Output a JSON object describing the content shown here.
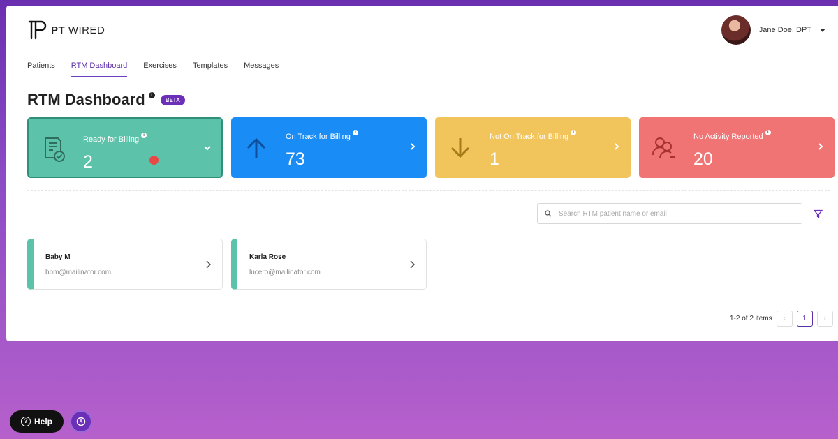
{
  "brand": {
    "bold": "PT",
    "rest": " WIRED"
  },
  "user": {
    "name": "Jane Doe, DPT"
  },
  "nav": [
    {
      "label": "Patients",
      "active": false
    },
    {
      "label": "RTM Dashboard",
      "active": true
    },
    {
      "label": "Exercises",
      "active": false
    },
    {
      "label": "Templates",
      "active": false
    },
    {
      "label": "Messages",
      "active": false
    }
  ],
  "page": {
    "title": "RTM Dashboard",
    "badge": "BETA",
    "info": "i"
  },
  "cards": [
    {
      "label": "Ready for Billing",
      "value": "2",
      "color": "#5cc3aa",
      "icon": "billing-check-icon",
      "chevron": "chevron-down-icon"
    },
    {
      "label": "On Track for Billing",
      "value": "73",
      "color": "#1a8cf5",
      "icon": "arrow-up-icon",
      "chevron": "chevron-right-icon"
    },
    {
      "label": "Not On Track for Billing",
      "value": "1",
      "color": "#f2c55c",
      "icon": "arrow-down-icon",
      "chevron": "chevron-right-icon"
    },
    {
      "label": "No Activity Reported",
      "value": "20",
      "color": "#f07474",
      "icon": "users-minus-icon",
      "chevron": "chevron-right-icon"
    }
  ],
  "search": {
    "placeholder": "Search RTM patient name or email",
    "value": ""
  },
  "patients": [
    {
      "name": "Baby M",
      "email": "bbm@mailinator.com"
    },
    {
      "name": "Karla Rose",
      "email": "lucero@mailinator.com"
    }
  ],
  "pagination": {
    "info": "1-2 of 2 items",
    "current": "1",
    "prev": "‹",
    "next": "›"
  },
  "help": {
    "label": "Help",
    "icon": "?"
  },
  "colors": {
    "accent": "#5a2ea6",
    "beta": "#6b2fb8"
  }
}
